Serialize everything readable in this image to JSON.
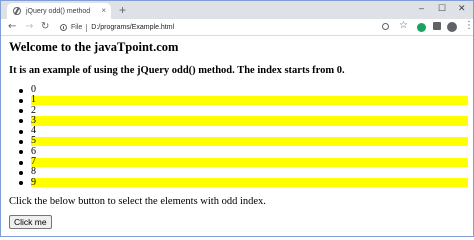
{
  "browser": {
    "tab_title": "jQuery odd() method",
    "tab_close": "×",
    "new_tab": "+",
    "window": {
      "minimize": "–",
      "maximize": "☐",
      "close": "✕"
    },
    "nav": {
      "back": "←",
      "forward": "→",
      "reload": "↻"
    },
    "scheme_label": "File",
    "url": "D:/programs/Example.html",
    "star": "☆",
    "menu": "⋮"
  },
  "page": {
    "heading": "Welcome to the javaTpoint.com",
    "subheading": "It is an example of using the jQuery odd() method. The index starts from 0.",
    "items": [
      {
        "label": "0",
        "highlighted": false
      },
      {
        "label": "1",
        "highlighted": true
      },
      {
        "label": "2",
        "highlighted": false
      },
      {
        "label": "3",
        "highlighted": true
      },
      {
        "label": "4",
        "highlighted": false
      },
      {
        "label": "5",
        "highlighted": true
      },
      {
        "label": "6",
        "highlighted": false
      },
      {
        "label": "7",
        "highlighted": true
      },
      {
        "label": "8",
        "highlighted": false
      },
      {
        "label": "9",
        "highlighted": true
      }
    ],
    "hint": "Click the below button to select the elements with odd index.",
    "button_label": "Click me"
  },
  "colors": {
    "highlight": "#ffff00",
    "tabstrip": "#dee1e6",
    "window_border": "#7f9dd6"
  },
  "icons": [
    "globe-icon",
    "info-icon",
    "zoom-icon",
    "star-icon",
    "extension-icon",
    "puzzle-icon",
    "profile-icon",
    "menu-icon"
  ]
}
